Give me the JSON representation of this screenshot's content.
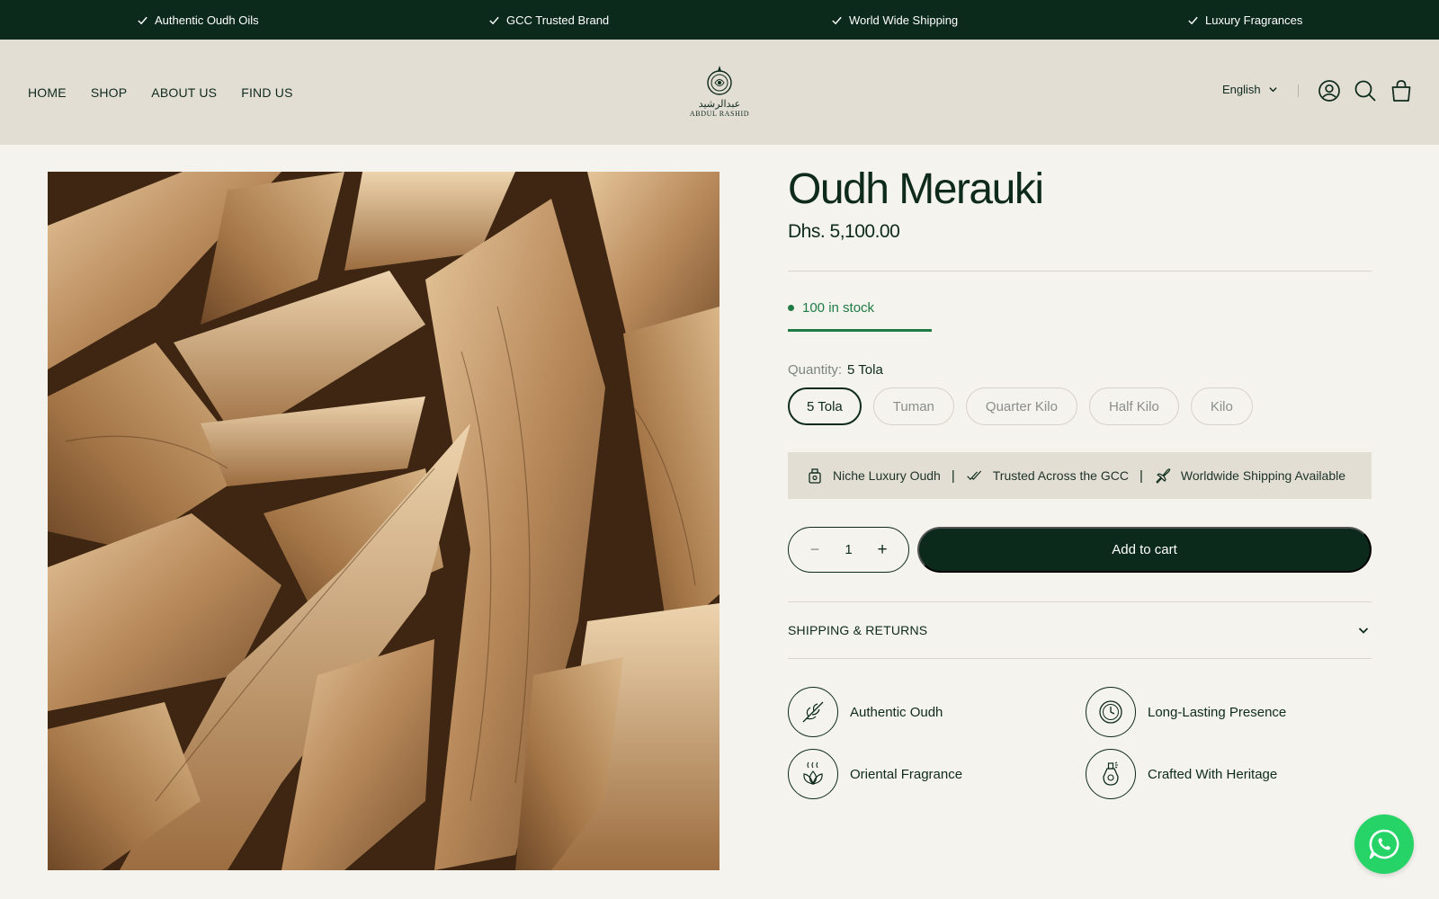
{
  "announcement": {
    "items": [
      "Authentic Oudh Oils",
      "GCC Trusted Brand",
      "World Wide Shipping",
      "Luxury Fragrances"
    ],
    "check_icon": "check-icon"
  },
  "header": {
    "nav": [
      "HOME",
      "SHOP",
      "ABOUT US",
      "FIND US"
    ],
    "logo": {
      "script": "عبدالرشيد",
      "name": "ABDUL RASHID"
    },
    "language": "English",
    "icons": [
      "account-icon",
      "search-icon",
      "cart-icon"
    ]
  },
  "product": {
    "title": "Oudh Merauki",
    "price": "Dhs. 5,100.00",
    "stock_text": "100 in stock",
    "stock_level": 0.5,
    "quantity_label": "Quantity:",
    "quantity_value": "5 Tola",
    "options": [
      "5 Tola",
      "Tuman",
      "Quarter Kilo",
      "Half Kilo",
      "Kilo"
    ],
    "selected_option": "5 Tola",
    "badges": [
      "Niche Luxury Oudh",
      "Trusted Across the GCC",
      "Worldwide Shipping Available"
    ],
    "badge_separator": "|",
    "qty_minus": "−",
    "qty_value": "1",
    "qty_plus": "+",
    "add_to_cart": "Add to cart",
    "accordion_label": "SHIPPING & RETURNS",
    "features": [
      "Authentic Oudh",
      "Long-Lasting Presence",
      "Oriental Fragrance",
      "Crafted With Heritage"
    ]
  },
  "colors": {
    "brand_dark": "#0c2a1c",
    "stock_green": "#1f7a45",
    "header_bg": "#e3ded4",
    "page_bg": "#f5f3ee",
    "whatsapp_green": "#25d366"
  }
}
